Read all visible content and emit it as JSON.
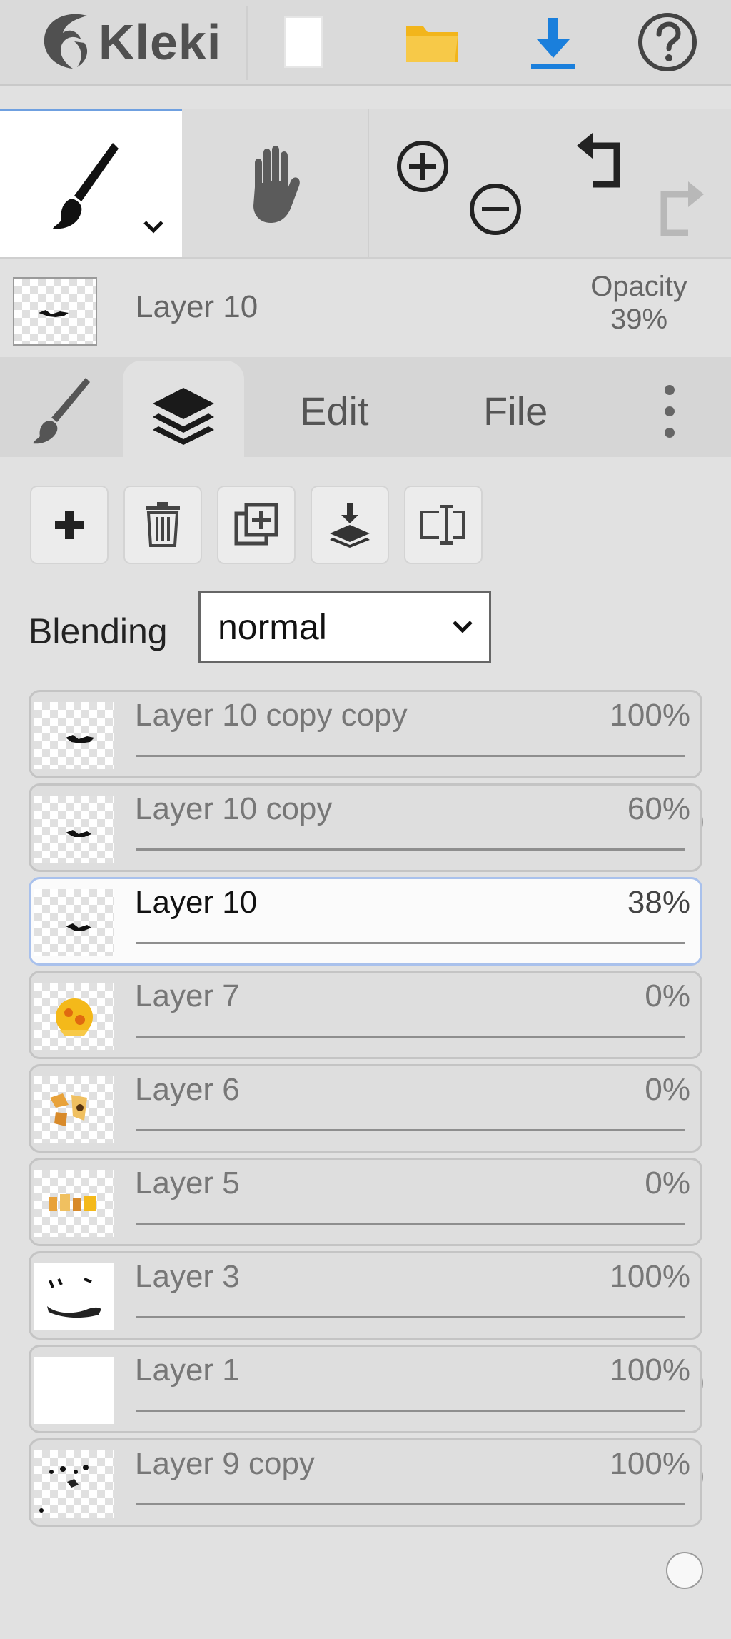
{
  "app": {
    "name": "Kleki"
  },
  "header": {
    "icons": [
      "new-image-icon",
      "open-folder-icon",
      "download-icon",
      "help-icon"
    ],
    "accent_folder": "#f4bd1f",
    "accent_download": "#1a7fdc"
  },
  "tools": {
    "active": "brush",
    "items": [
      "brush-icon",
      "hand-icon",
      "zoom-in-icon",
      "zoom-out-icon",
      "undo-icon",
      "redo-icon"
    ]
  },
  "current_layer": {
    "name": "Layer 10",
    "opacity_label": "Opacity",
    "opacity_value": "39%"
  },
  "tabs": [
    {
      "id": "brush",
      "icon": "brush-icon"
    },
    {
      "id": "layers",
      "icon": "layers-icon",
      "active": true
    },
    {
      "id": "edit",
      "label": "Edit"
    },
    {
      "id": "file",
      "label": "File"
    },
    {
      "id": "more",
      "icon": "more-vertical-icon"
    }
  ],
  "layer_actions": [
    "add-layer-icon",
    "delete-layer-icon",
    "duplicate-layer-icon",
    "merge-down-icon",
    "rename-layer-icon"
  ],
  "blending": {
    "label": "Blending",
    "value": "normal"
  },
  "layers": [
    {
      "name": "Layer 10 copy copy",
      "opacity": "100%",
      "level": 1.0,
      "selected": false
    },
    {
      "name": "Layer 10 copy",
      "opacity": "60%",
      "level": 0.6,
      "selected": false
    },
    {
      "name": "Layer 10",
      "opacity": "38%",
      "level": 0.38,
      "selected": true
    },
    {
      "name": "Layer 7",
      "opacity": "0%",
      "level": 0.0,
      "selected": false
    },
    {
      "name": "Layer 6",
      "opacity": "0%",
      "level": 0.0,
      "selected": false
    },
    {
      "name": "Layer 5",
      "opacity": "0%",
      "level": 0.0,
      "selected": false
    },
    {
      "name": "Layer 3",
      "opacity": "100%",
      "level": 1.0,
      "selected": false
    },
    {
      "name": "Layer 1",
      "opacity": "100%",
      "level": 1.0,
      "selected": false
    },
    {
      "name": "Layer 9 copy",
      "opacity": "100%",
      "level": 1.0,
      "selected": false
    }
  ]
}
